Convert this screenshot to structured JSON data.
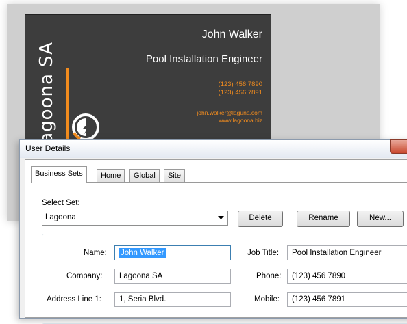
{
  "card": {
    "name": "John Walker",
    "title": "Pool Installation Engineer",
    "phone1": "(123) 456 7890",
    "phone2": "(123) 456 7891",
    "email": "john.walker@laguna.com",
    "website": "www.lagoona.biz",
    "brand": "lagoona SA",
    "logo_icon": "lagoona-logo-icon",
    "colors": {
      "background": "#3d3d3d",
      "accent": "#f28c1e",
      "text": "#ffffff"
    }
  },
  "dialog": {
    "title": "User Details",
    "tabs": [
      {
        "label": "Business Sets",
        "active": true
      },
      {
        "label": "Home",
        "active": false
      },
      {
        "label": "Global",
        "active": false
      },
      {
        "label": "Site",
        "active": false
      }
    ],
    "select_set": {
      "label": "Select Set:",
      "value": "Lagoona"
    },
    "buttons": {
      "delete": "Delete",
      "rename": "Rename",
      "new": "New..."
    },
    "fields": {
      "name": {
        "label": "Name:",
        "value": "John Walker"
      },
      "company": {
        "label": "Company:",
        "value": "Lagoona SA"
      },
      "address1": {
        "label": "Address Line 1:",
        "value": "1, Seria Blvd."
      },
      "job_title": {
        "label": "Job Title:",
        "value": "Pool Installation Engineer"
      },
      "phone": {
        "label": "Phone:",
        "value": "(123) 456 7890"
      },
      "mobile": {
        "label": "Mobile:",
        "value": "(123) 456 7891"
      }
    }
  }
}
